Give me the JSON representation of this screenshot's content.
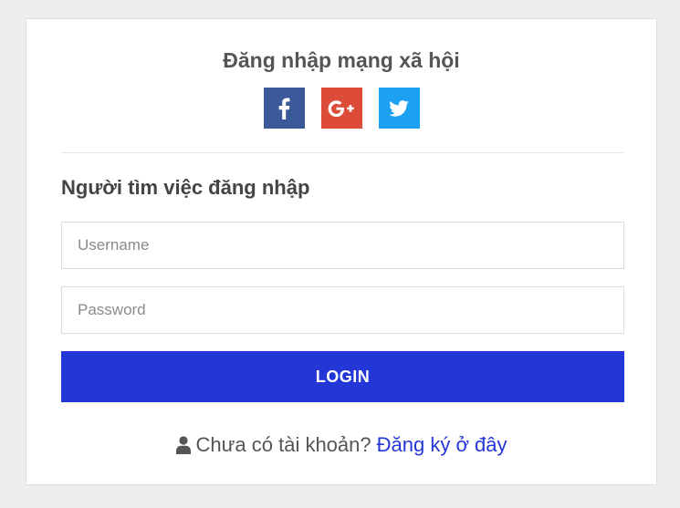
{
  "social": {
    "title": "Đăng nhập mạng xã hội",
    "buttons": [
      {
        "name": "facebook",
        "icon": "facebook-icon",
        "color": "#3b5998"
      },
      {
        "name": "google-plus",
        "icon": "google-plus-icon",
        "color": "#dd4b39"
      },
      {
        "name": "twitter",
        "icon": "twitter-icon",
        "color": "#1da1f2"
      }
    ]
  },
  "login": {
    "title": "Người tìm việc đăng nhập",
    "username_placeholder": "Username",
    "password_placeholder": "Password",
    "button_label": "LOGIN",
    "button_color": "#2336d6"
  },
  "signup": {
    "icon": "user-icon",
    "prompt": "Chưa có tài khoản?",
    "link_label": "Đăng ký ở đây"
  }
}
